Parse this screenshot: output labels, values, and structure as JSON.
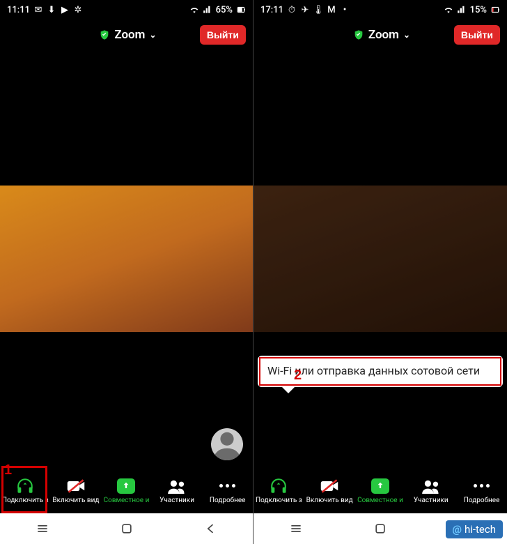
{
  "left": {
    "statusbar": {
      "time": "11:11",
      "battery": "65%"
    },
    "header": {
      "title": "Zoom",
      "leave": "Выйти"
    },
    "toolbar": {
      "audio": "Подключить з",
      "video": "Включить вид",
      "share": "Совместное и",
      "participants": "Участники",
      "more": "Подробнее"
    },
    "highlight_num": "1"
  },
  "right": {
    "statusbar": {
      "time": "17:11",
      "battery": "15%"
    },
    "header": {
      "title": "Zoom",
      "leave": "Выйти"
    },
    "toolbar": {
      "audio": "Подключить з",
      "video": "Включить вид",
      "share": "Совместное и",
      "participants": "Участники",
      "more": "Подробнее"
    },
    "popup_text": "Wi-Fi или отправка данных сотовой сети",
    "highlight_num": "2"
  },
  "watermark": "hi-tech"
}
